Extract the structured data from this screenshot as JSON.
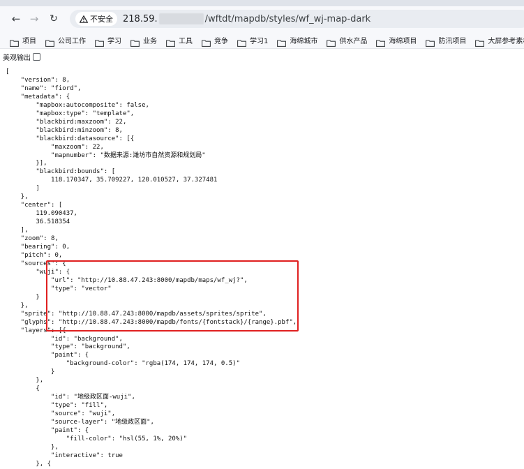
{
  "browser": {
    "security_label": "不安全",
    "url_host": "218.59.",
    "url_path": "/wftdt/mapdb/styles/wf_wj-map-dark"
  },
  "bookmarks": [
    {
      "label": "项目"
    },
    {
      "label": "公司工作"
    },
    {
      "label": "学习"
    },
    {
      "label": "业务"
    },
    {
      "label": "工具"
    },
    {
      "label": "竞争"
    },
    {
      "label": "学习1"
    },
    {
      "label": "海绵城市"
    },
    {
      "label": "供水产品"
    },
    {
      "label": "海绵项目"
    },
    {
      "label": "防汛项目"
    },
    {
      "label": "大屏参考素材"
    }
  ],
  "page": {
    "pretty_print_label": "美观输出",
    "json_lines": [
      "[",
      "    \"version\": 8,",
      "    \"name\": \"fiord\",",
      "    \"metadata\": {",
      "        \"mapbox:autocomposite\": false,",
      "        \"mapbox:type\": \"template\",",
      "        \"blackbird:maxzoom\": 22,",
      "        \"blackbird:minzoom\": 8,",
      "        \"blackbird:datasource\": [{",
      "            \"maxzoom\": 22,",
      "            \"mapnumber\": \"数据来源:潍坊市自然资源和规划局\"",
      "        }],",
      "        \"blackbird:bounds\": [",
      "            118.170347, 35.709227, 120.010527, 37.327481",
      "        ]",
      "    },",
      "    \"center\": [",
      "        119.090437,",
      "        36.518354",
      "    ],",
      "    \"zoom\": 8,",
      "    \"bearing\": 0,",
      "    \"pitch\": 0,",
      "    \"sources\": {",
      "        \"wuji\": {",
      "            \"url\": \"http://10.88.47.243:8000/mapdb/maps/wf_wj?\",",
      "            \"type\": \"vector\"",
      "        }",
      "    },",
      "    \"sprite\": \"http://10.88.47.243:8000/mapdb/assets/sprites/sprite\",",
      "    \"glyphs\": \"http://10.88.47.243:8000/mapdb/fonts/{fontstack}/{range}.pbf\",",
      "    \"layers\": [{",
      "            \"id\": \"background\",",
      "            \"type\": \"background\",",
      "            \"paint\": {",
      "                \"background-color\": \"rgba(174, 174, 174, 0.5)\"",
      "            }",
      "        },",
      "        {",
      "            \"id\": \"地级政区面-wuji\",",
      "            \"type\": \"fill\",",
      "            \"source\": \"wuji\",",
      "            \"source-layer\": \"地级政区面\",",
      "            \"paint\": {",
      "                \"fill-color\": \"hsl(55, 1%, 20%)\"",
      "            },",
      "            \"interactive\": true",
      "        }, {"
    ]
  },
  "colors": {
    "highlight_border": "#e02020",
    "warning": "#202124"
  }
}
